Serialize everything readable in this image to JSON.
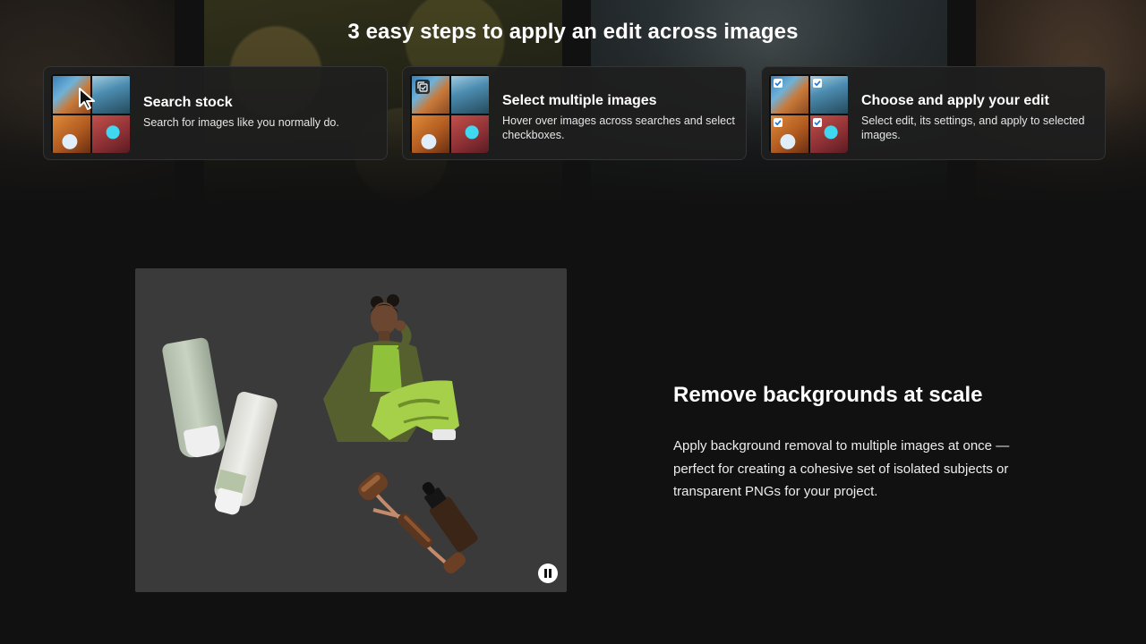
{
  "hero": {
    "title": "3 easy steps to apply an edit across images"
  },
  "steps": [
    {
      "title": "Search stock",
      "description": "Search for images like you normally do.",
      "icon": "cursor-icon"
    },
    {
      "title": "Select multiple images",
      "description": "Hover over images across searches and select checkboxes.",
      "icon": "copy-check-icon"
    },
    {
      "title": "Choose and apply your edit",
      "description": "Select edit, its settings, and apply to selected images.",
      "icon": "checkbox-icon"
    }
  ],
  "feature": {
    "title": "Remove backgrounds at scale",
    "description": "Apply background removal to multiple images at once — perfect for creating a cohesive set of isolated subjects or transparent PNGs for your project.",
    "media_control_icon": "pause-icon"
  },
  "colors": {
    "page_background": "#111111",
    "card_background": "#1e1e1e",
    "media_background": "#3a3a3a"
  }
}
